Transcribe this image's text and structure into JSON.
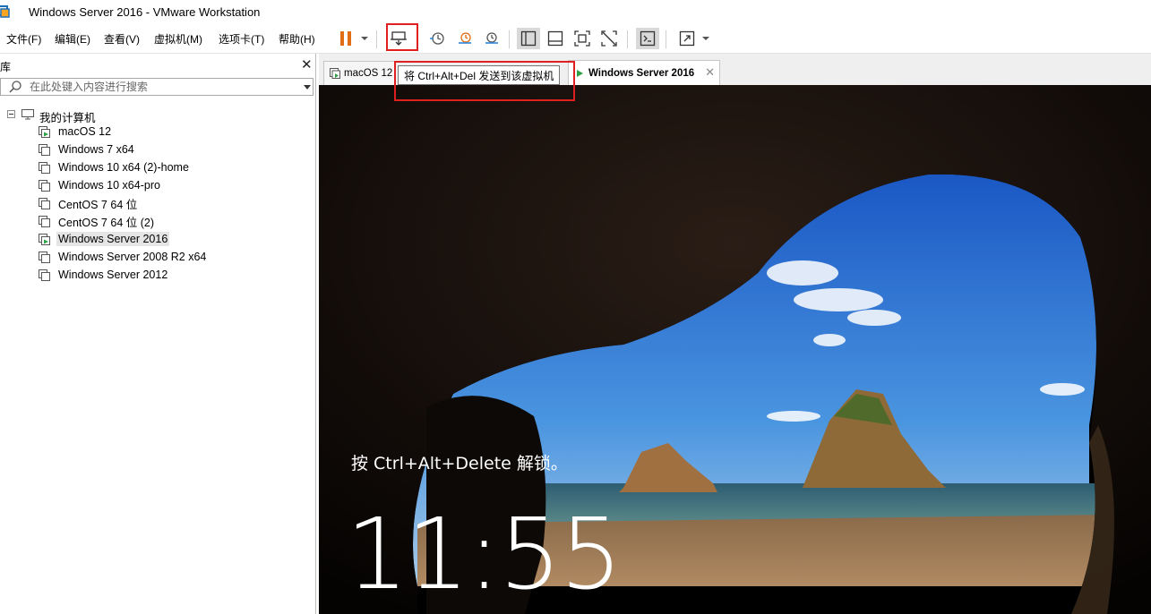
{
  "window": {
    "title": "Windows Server 2016 - VMware Workstation"
  },
  "menubar": {
    "items": [
      "文件(F)",
      "编辑(E)",
      "查看(V)",
      "虚拟机(M)",
      "选项卡(T)",
      "帮助(H)"
    ]
  },
  "toolbar": {
    "tooltip": "将 Ctrl+Alt+Del 发送到该虚拟机",
    "accent_color": "#e06c13",
    "highlight_color": "#e02020"
  },
  "library": {
    "title": "库",
    "search_placeholder": "在此处键入内容进行搜索",
    "root": "我的计算机",
    "vms": [
      {
        "name": "macOS 12",
        "running": true
      },
      {
        "name": "Windows 7 x64",
        "running": false
      },
      {
        "name": "Windows 10 x64 (2)-home",
        "running": false
      },
      {
        "name": "Windows 10 x64-pro",
        "running": false
      },
      {
        "name": "CentOS 7 64 位",
        "running": false
      },
      {
        "name": "CentOS 7 64 位 (2)",
        "running": false
      },
      {
        "name": "Windows Server 2016",
        "running": true,
        "selected": true
      },
      {
        "name": "Windows Server 2008 R2 x64",
        "running": false
      },
      {
        "name": "Windows Server 2012",
        "running": false
      }
    ]
  },
  "tabs": [
    {
      "label": "macOS 12",
      "active": false
    },
    {
      "label": "Windows Server 2016",
      "active": true
    }
  ],
  "vm_screen": {
    "lock_prompt": "按 Ctrl+Alt+Delete 解锁。",
    "time": "11:55"
  }
}
